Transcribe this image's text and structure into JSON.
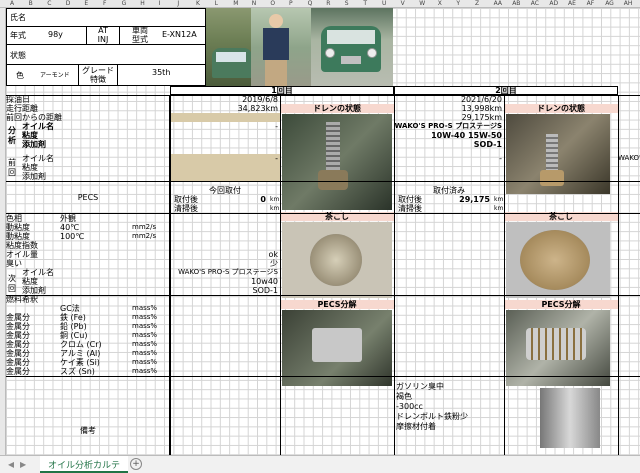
{
  "sheet": {
    "columns": [
      "A",
      "B",
      "C",
      "D",
      "E",
      "F",
      "G",
      "H",
      "I",
      "J",
      "K",
      "L",
      "M",
      "N",
      "O",
      "P",
      "Q",
      "R",
      "S",
      "T",
      "U",
      "V",
      "W",
      "X",
      "Y",
      "Z",
      "AA",
      "AB",
      "AC",
      "AD",
      "AE",
      "AF",
      "AG",
      "AH"
    ]
  },
  "profile": {
    "name_label": "氏名",
    "year_label": "年式",
    "year_value": "98y",
    "trans": "AT\nINJ",
    "model_label": "車両\n型式",
    "model_value": "E-XN12A",
    "state_label": "状態",
    "color_label": "色",
    "color_value": "アーモンド",
    "grade_label": "グレード\n特徴",
    "grade_value": "35th"
  },
  "rounds": {
    "r1": "1回目",
    "r2": "2回目"
  },
  "labels": {
    "date": "採油日",
    "mileage": "走行距離",
    "since_prev": "前回からの距離",
    "analysis": "分析",
    "oil_name": "オイル名",
    "viscosity": "粘度",
    "additive": "添加剤",
    "previous": "前回",
    "pecs": "PECS",
    "color_hue": "色相",
    "appearance": "外観",
    "visc": "動粘度",
    "visc40": "40℃",
    "visc100": "100℃",
    "unit_mm2": "mm2/s",
    "visc_index": "粘度指数",
    "oil_amount": "オイル量",
    "smell": "臭い",
    "next": "次回",
    "fuel_dilution": "燃料希釈",
    "metal": "金属分",
    "gc": "GC法",
    "fe": "鉄 (Fe)",
    "pb": "鉛 (Pb)",
    "cu": "銅 (Cu)",
    "cr": "クロム (Cr)",
    "al": "アルミ (Al)",
    "si": "ケイ素 (Si)",
    "sn": "スズ (Sn)",
    "unit_mass": "mass%",
    "remarks": "備考"
  },
  "r1": {
    "date": "2019/6/8",
    "mileage": "34,823km",
    "dash": "-",
    "pecs_title": "今回取付",
    "pecs_mount": "取付後",
    "pecs_clean": "清掃後",
    "pecs_mount_val": "0",
    "km": "km",
    "oil_amount": "ok",
    "smell": "少",
    "next_oil": "WAKO'S PRO-S プロステージS",
    "next_visc": "10w40",
    "next_add": "SOD-1"
  },
  "r2": {
    "date": "2021/6/20",
    "mileage": "13,998km",
    "since": "29,175km",
    "oil_name": "WAKO'S PRO-S プロステージS",
    "visc": "10W-40 15W-50",
    "add": "SOD-1",
    "prev_dash": "-",
    "pecs_title": "取付済み",
    "pecs_mount": "取付後",
    "pecs_clean": "清掃後",
    "pecs_mount_val": "29,175",
    "km": "km",
    "remarks": [
      "ガソリン臭中",
      "褐色",
      "-300cc",
      "ドレンボルト鉄粉少",
      "摩擦材付着"
    ]
  },
  "r3": {
    "prev_name": "WAKO'S"
  },
  "panels": {
    "drain": "ドレンの状態",
    "strainer": "茶こし",
    "pecs_analysis": "PECS分解"
  },
  "tabs": {
    "sheet_name": "オイル分析カルテ",
    "add": "+"
  }
}
